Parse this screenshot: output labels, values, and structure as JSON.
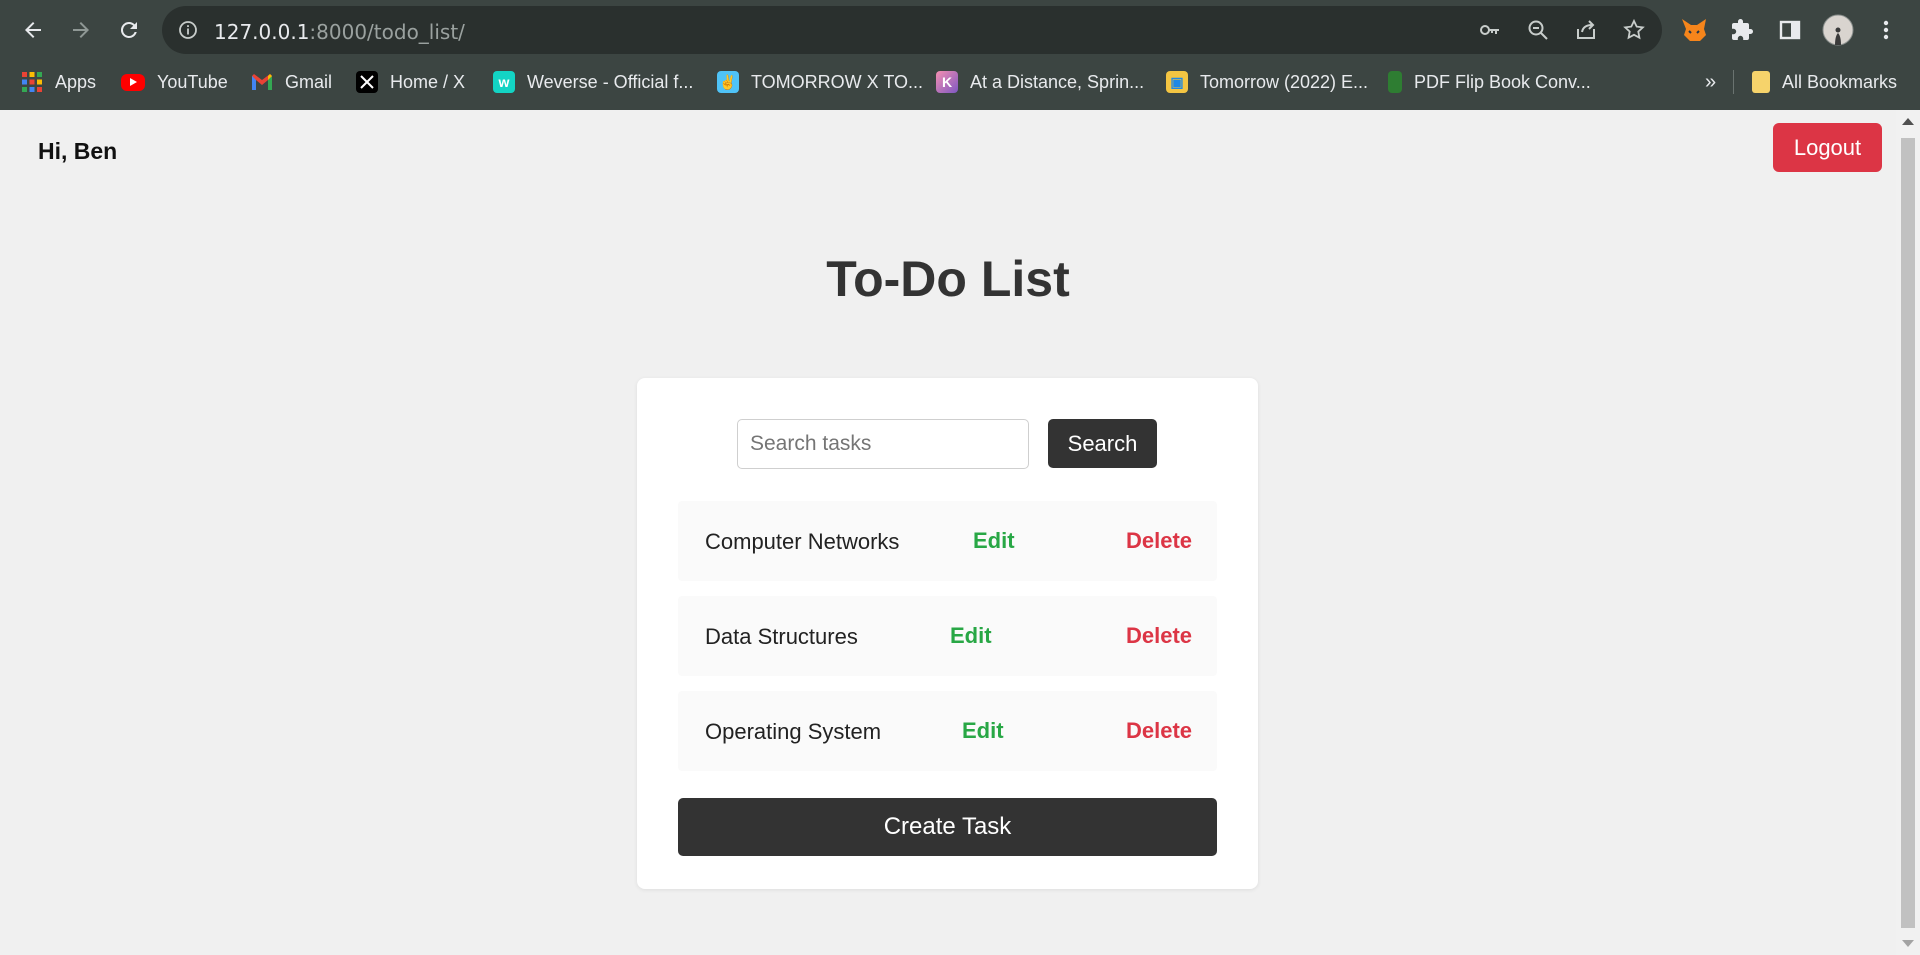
{
  "browser": {
    "url_host": "127.0.0.1",
    "url_path": ":8000/todo_list/",
    "bookmarks": [
      {
        "label": "Apps",
        "icon": "apps-grid-icon",
        "color": "#ea4335"
      },
      {
        "label": "YouTube",
        "icon": "youtube-icon",
        "color": "#ff0000"
      },
      {
        "label": "Gmail",
        "icon": "gmail-icon",
        "color": "#ea4335"
      },
      {
        "label": "Home / X",
        "icon": "x-icon",
        "color": "#000000"
      },
      {
        "label": "Weverse - Official f...",
        "icon": "weverse-icon",
        "color": "#13d4c4"
      },
      {
        "label": "TOMORROW X TO...",
        "icon": "txt-icon",
        "color": "#4fc3f7"
      },
      {
        "label": "At a Distance, Sprin...",
        "icon": "k-icon",
        "color": "#7e57c2"
      },
      {
        "label": "Tomorrow (2022) E...",
        "icon": "tomorrow-icon",
        "color": "#f4c542"
      },
      {
        "label": "PDF Flip Book Conv...",
        "icon": "book-icon",
        "color": "#2e7d32"
      }
    ],
    "overflow_label": "»",
    "all_bookmarks_label": "All Bookmarks"
  },
  "page": {
    "greeting": "Hi, Ben",
    "logout_label": "Logout",
    "title": "To-Do List",
    "search": {
      "placeholder": "Search tasks",
      "button_label": "Search"
    },
    "tasks": [
      {
        "name": "Computer Networks",
        "edit_label": "Edit",
        "delete_label": "Delete"
      },
      {
        "name": "Data Structures",
        "edit_label": "Edit",
        "delete_label": "Delete"
      },
      {
        "name": "Operating System",
        "edit_label": "Edit",
        "delete_label": "Delete"
      }
    ],
    "create_label": "Create Task"
  },
  "colors": {
    "accent_danger": "#dc3545",
    "accent_success": "#28a745",
    "dark_button": "#333333"
  }
}
